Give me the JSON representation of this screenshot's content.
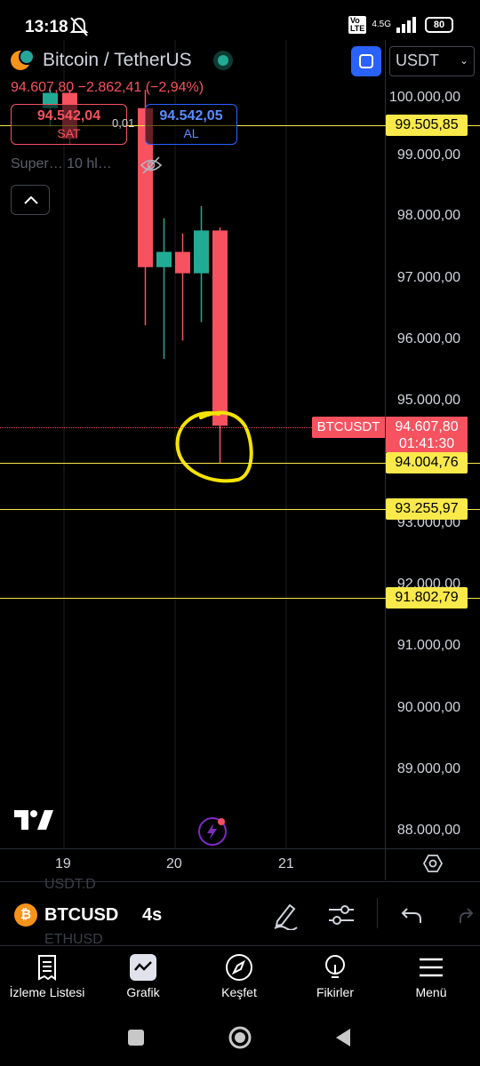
{
  "status": {
    "time": "13:18",
    "network": "4.5G",
    "battery": "80"
  },
  "header": {
    "symbol_title": "Bitcoin / TetherUS",
    "price_change": "94.607,80  −2.862,41 (−2,94%)",
    "sell": {
      "price": "94.542,04",
      "label": "SAT"
    },
    "buy": {
      "price": "94.542,05",
      "label": "AL"
    },
    "spread": "0,01",
    "indicator": "Super… 10 hl…",
    "currency": "USDT"
  },
  "price_axis": [
    "100.000,00",
    "99.000,00",
    "98.000,00",
    "97.000,00",
    "96.000,00",
    "95.000,00",
    "93.000,00",
    "92.000,00",
    "91.000,00",
    "90.000,00",
    "89.000,00",
    "88.000,00"
  ],
  "levels": [
    "99.505,85",
    "94.004,76",
    "93.255,97",
    "91.802,79"
  ],
  "last_price": {
    "symbol": "BTCUSDT",
    "price": "94.607,80",
    "countdown": "01:41:30"
  },
  "time_axis": [
    "19",
    "20",
    "21"
  ],
  "chart_data": {
    "type": "candlestick",
    "series": [
      {
        "open": 99800,
        "high": 100100,
        "low": 99500,
        "close": 100050,
        "color": "teal"
      },
      {
        "open": 100050,
        "high": 100100,
        "low": 99200,
        "close": 99300,
        "color": "red"
      },
      {
        "open": 99800,
        "high": 100100,
        "low": 96250,
        "close": 97200,
        "color": "red"
      },
      {
        "open": 97200,
        "high": 98000,
        "low": 95700,
        "close": 97450,
        "color": "teal"
      },
      {
        "open": 97450,
        "high": 97750,
        "low": 96000,
        "close": 97100,
        "color": "red"
      },
      {
        "open": 97100,
        "high": 98200,
        "low": 96300,
        "close": 97800,
        "color": "teal"
      },
      {
        "open": 97800,
        "high": 97850,
        "low": 94000,
        "close": 94607.8,
        "color": "red"
      }
    ],
    "ylim": [
      87500,
      101000
    ],
    "horizontal_levels": [
      99505.85,
      94004.76,
      93255.97,
      91802.79
    ],
    "colors": {
      "up": "#22ab94",
      "down": "#f7525f",
      "level": "#f7e94c",
      "highlight": "#f5e400"
    }
  },
  "toolbar": {
    "symbol": "BTCUSD",
    "interval": "4s",
    "ghost_above": "USDT.D",
    "ghost_below": "ETHUSD"
  },
  "nav": [
    {
      "label": "İzleme Listesi",
      "icon": "watchlist-icon"
    },
    {
      "label": "Grafik",
      "icon": "chart-icon"
    },
    {
      "label": "Keşfet",
      "icon": "compass-icon"
    },
    {
      "label": "Fikirler",
      "icon": "lightbulb-icon"
    },
    {
      "label": "Menü",
      "icon": "menu-icon"
    }
  ]
}
